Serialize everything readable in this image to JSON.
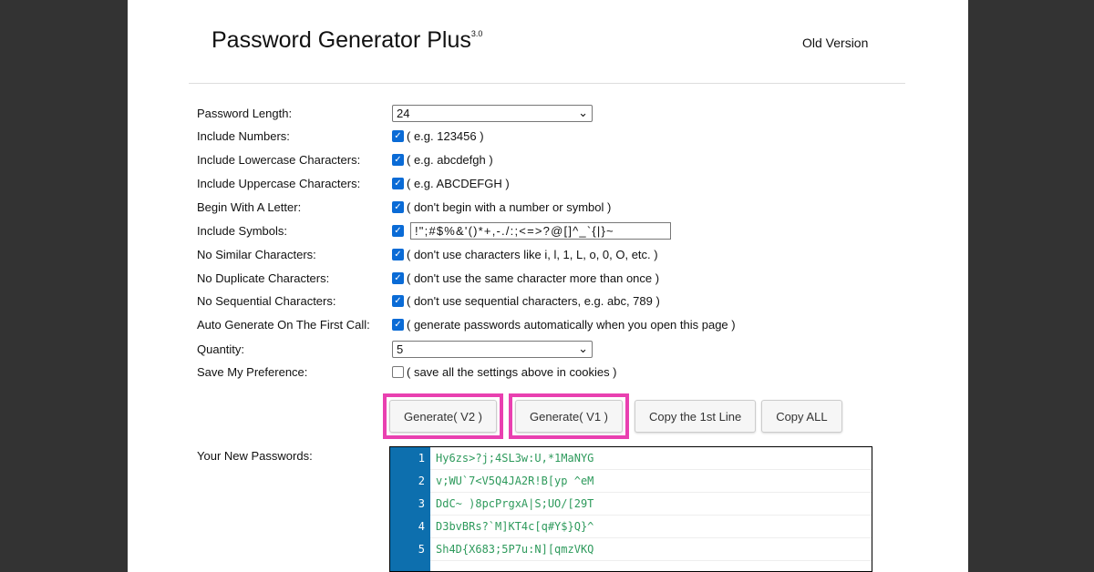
{
  "header": {
    "title": "Password Generator Plus",
    "version": "3.0",
    "old_version": "Old Version"
  },
  "form": {
    "length": {
      "label": "Password Length:",
      "value": "24"
    },
    "numbers": {
      "label": "Include Numbers:",
      "hint": "( e.g. 123456 )",
      "checked": true
    },
    "lower": {
      "label": "Include Lowercase Characters:",
      "hint": "( e.g. abcdefgh )",
      "checked": true
    },
    "upper": {
      "label": "Include Uppercase Characters:",
      "hint": "( e.g. ABCDEFGH )",
      "checked": true
    },
    "letter": {
      "label": "Begin With A Letter:",
      "hint": "( don't begin with a number or symbol )",
      "checked": true
    },
    "symbols": {
      "label": "Include Symbols:",
      "value": "!\";#$%&'()*+,-./:;<=>?@[]^_`{|}~",
      "checked": true
    },
    "similar": {
      "label": "No Similar Characters:",
      "hint": "( don't use characters like i, l, 1, L, o, 0, O, etc. )",
      "checked": true
    },
    "duplicate": {
      "label": "No Duplicate Characters:",
      "hint": "( don't use the same character more than once )",
      "checked": true
    },
    "sequential": {
      "label": "No Sequential Characters:",
      "hint": "( don't use sequential characters, e.g. abc, 789 )",
      "checked": true
    },
    "auto": {
      "label": "Auto Generate On The First Call:",
      "hint": "( generate passwords automatically when you open this page )",
      "checked": true
    },
    "quantity": {
      "label": "Quantity:",
      "value": "5"
    },
    "save": {
      "label": "Save My Preference:",
      "hint": "( save all the settings above in cookies )",
      "checked": false
    }
  },
  "buttons": {
    "gen_v2": "Generate( V2 )",
    "gen_v1": "Generate( V1 )",
    "copy_first": "Copy the 1st Line",
    "copy_all": "Copy ALL"
  },
  "output": {
    "label": "Your New Passwords:",
    "line_numbers": [
      "1",
      "2",
      "3",
      "4",
      "5"
    ],
    "passwords": [
      "Hy6zs>?j;4SL3w:U,*1MaNYG",
      "v;WU`7<V5Q4JA2R!B[yp ^eM",
      "DdC~ )8pcPrgxA|S;UO/[29T",
      "D3bvBRs?`M]KT4c[q#Y$}Q}^",
      "Sh4D{X683;5P7u:N][qmzVKQ"
    ]
  },
  "colors": {
    "highlight": "#e940b0",
    "gutter": "#0d6fae",
    "password_text": "#2e9a5c"
  }
}
